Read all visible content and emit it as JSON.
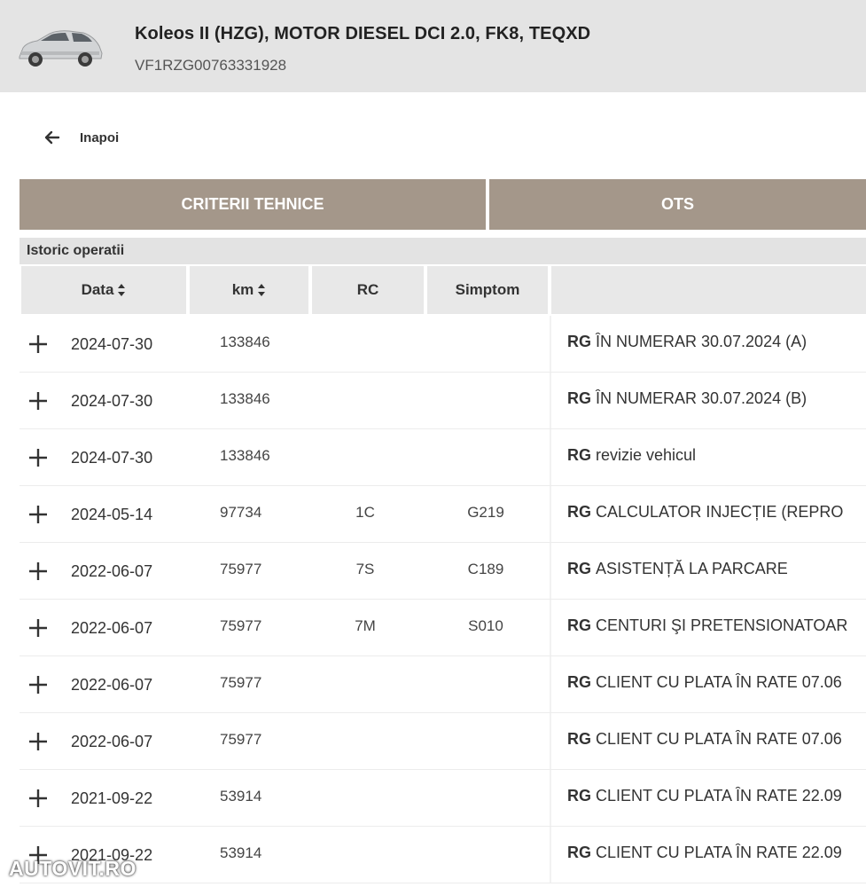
{
  "header": {
    "vehicle_title": "Koleos II (HZG), MOTOR DIESEL DCI 2.0, FK8, TEQXD",
    "vin": "VF1RZG00763331928"
  },
  "back": {
    "label": "Inapoi"
  },
  "tabs": [
    {
      "label": "CRITERII TEHNICE"
    },
    {
      "label": "OTS"
    }
  ],
  "history": {
    "title": "Istoric operatii",
    "columns": {
      "date": "Data",
      "km": "km",
      "rc": "RC",
      "symptom": "Simptom"
    },
    "rows": [
      {
        "date": "2024-07-30",
        "km": "133846",
        "rc": "",
        "symptom": "",
        "tag": "RG",
        "description": "ÎN NUMERAR 30.07.2024 (A)"
      },
      {
        "date": "2024-07-30",
        "km": "133846",
        "rc": "",
        "symptom": "",
        "tag": "RG",
        "description": "ÎN NUMERAR 30.07.2024 (B)"
      },
      {
        "date": "2024-07-30",
        "km": "133846",
        "rc": "",
        "symptom": "",
        "tag": "RG",
        "description": "revizie vehicul"
      },
      {
        "date": "2024-05-14",
        "km": "97734",
        "rc": "1C",
        "symptom": "G219",
        "tag": "RG",
        "description": "CALCULATOR INJECȚIE (REPRO"
      },
      {
        "date": "2022-06-07",
        "km": "75977",
        "rc": "7S",
        "symptom": "C189",
        "tag": "RG",
        "description": "ASISTENȚĂ LA PARCARE"
      },
      {
        "date": "2022-06-07",
        "km": "75977",
        "rc": "7M",
        "symptom": "S010",
        "tag": "RG",
        "description": "CENTURI ŞI PRETENSIONATOAR"
      },
      {
        "date": "2022-06-07",
        "km": "75977",
        "rc": "",
        "symptom": "",
        "tag": "RG",
        "description": "CLIENT CU PLATA ÎN RATE 07.06"
      },
      {
        "date": "2022-06-07",
        "km": "75977",
        "rc": "",
        "symptom": "",
        "tag": "RG",
        "description": "CLIENT CU PLATA ÎN RATE 07.06"
      },
      {
        "date": "2021-09-22",
        "km": "53914",
        "rc": "",
        "symptom": "",
        "tag": "RG",
        "description": "CLIENT CU PLATA ÎN RATE 22.09"
      },
      {
        "date": "2021-09-22",
        "km": "53914",
        "rc": "",
        "symptom": "",
        "tag": "RG",
        "description": "CLIENT CU PLATA ÎN RATE 22.09"
      }
    ]
  },
  "watermark": "AUTOVIT.RO",
  "colors": {
    "tab_bg": "#a4978a",
    "header_bg": "#e4e4e4",
    "table_head_bg": "#e8e8e8"
  }
}
